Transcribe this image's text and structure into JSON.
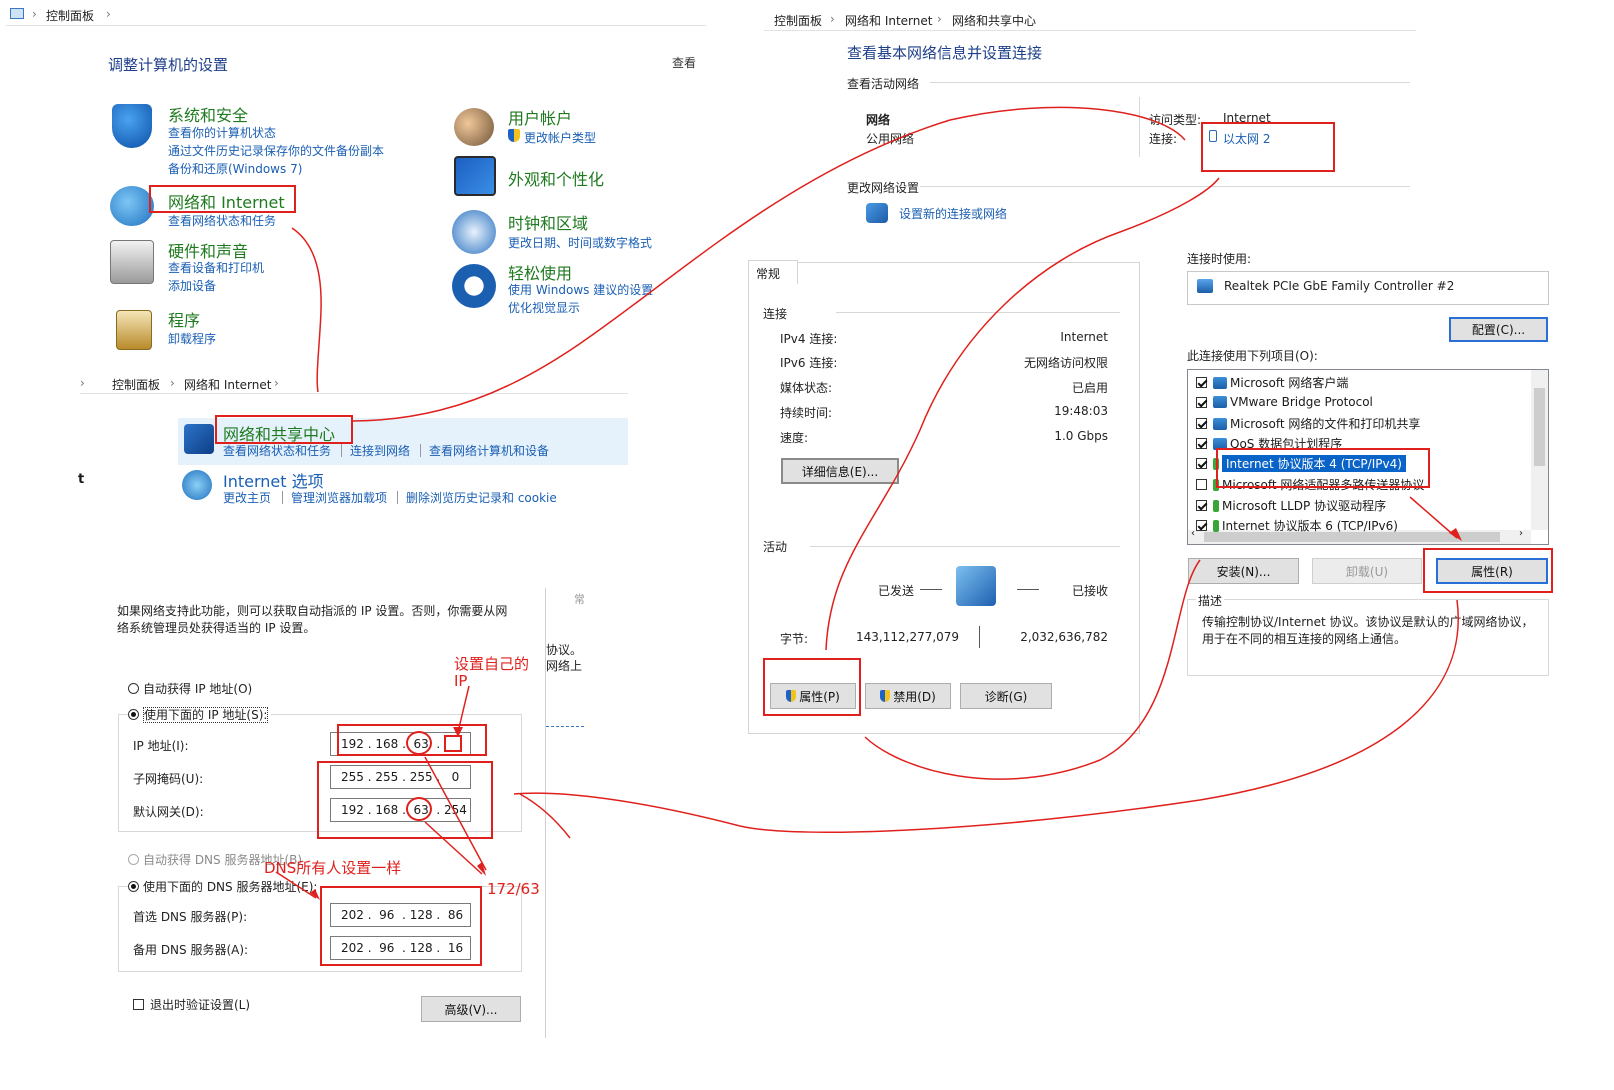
{
  "control_panel": {
    "breadcrumb": [
      "控制面板"
    ],
    "heading": "调整计算机的设置",
    "view_by": "查看",
    "categories_left": [
      {
        "title": "系统和安全",
        "links": [
          "查看你的计算机状态",
          "通过文件历史记录保存你的文件备份副本",
          "备份和还原(Windows 7)"
        ]
      },
      {
        "title": "网络和 Internet",
        "links": [
          "查看网络状态和任务"
        ]
      },
      {
        "title": "硬件和声音",
        "links": [
          "查看设备和打印机",
          "添加设备"
        ]
      },
      {
        "title": "程序",
        "links": [
          "卸载程序"
        ]
      }
    ],
    "categories_right": [
      {
        "title": "用户帐户",
        "links": [
          "更改帐户类型"
        ]
      },
      {
        "title": "外观和个性化",
        "links": []
      },
      {
        "title": "时钟和区域",
        "links": [
          "更改日期、时间或数字格式"
        ]
      },
      {
        "title": "轻松使用",
        "links": [
          "使用 Windows 建议的设置",
          "优化视觉显示"
        ]
      }
    ]
  },
  "network_internet": {
    "breadcrumb": [
      "控制面板",
      "网络和 Internet"
    ],
    "side_char": "t",
    "sharing_center": {
      "title": "网络和共享中心",
      "links": [
        "查看网络状态和任务",
        "连接到网络",
        "查看网络计算机和设备"
      ]
    },
    "internet_options": {
      "title": "Internet 选项",
      "links": [
        "更改主页",
        "管理浏览器加载项",
        "删除浏览历史记录和 cookie"
      ]
    }
  },
  "sharing_center": {
    "breadcrumb": [
      "控制面板",
      "网络和 Internet",
      "网络和共享中心"
    ],
    "heading": "查看基本网络信息并设置连接",
    "active_label": "查看活动网络",
    "network_name": "网络",
    "network_type": "公用网络",
    "access_label": "访问类型:",
    "access_value": "Internet",
    "conn_label": "连接:",
    "conn_value": "以太网 2",
    "change_label": "更改网络设置",
    "new_conn": "设置新的连接或网络"
  },
  "status_dialog": {
    "tab": "常规",
    "section_conn": "连接",
    "rows": [
      {
        "k": "IPv4 连接:",
        "v": "Internet"
      },
      {
        "k": "IPv6 连接:",
        "v": "无网络访问权限"
      },
      {
        "k": "媒体状态:",
        "v": "已启用"
      },
      {
        "k": "持续时间:",
        "v": "19:48:03"
      },
      {
        "k": "速度:",
        "v": "1.0 Gbps"
      }
    ],
    "details_btn": "详细信息(E)...",
    "section_activity": "活动",
    "sent": "已发送",
    "received": "已接收",
    "bytes_label": "字节:",
    "bytes_sent": "143,112,277,079",
    "bytes_recv": "2,032,636,782",
    "btn_props": "属性(P)",
    "btn_disable": "禁用(D)",
    "btn_diag": "诊断(G)"
  },
  "props_dialog": {
    "connect_using": "连接时使用:",
    "adapter": "Realtek PCIe GbE Family Controller #2",
    "configure": "配置(C)...",
    "items_label": "此连接使用下列项目(O):",
    "items": [
      {
        "label": "Microsoft 网络客户端",
        "checked": true
      },
      {
        "label": "VMware Bridge Protocol",
        "checked": true
      },
      {
        "label": "Microsoft 网络的文件和打印机共享",
        "checked": true
      },
      {
        "label": "QoS 数据包计划程序",
        "checked": true
      },
      {
        "label": "Internet 协议版本 4 (TCP/IPv4)",
        "checked": true
      },
      {
        "label": "Microsoft 网络适配器多路传送器协议",
        "checked": false
      },
      {
        "label": "Microsoft LLDP 协议驱动程序",
        "checked": true
      },
      {
        "label": "Internet 协议版本 6 (TCP/IPv6)",
        "checked": true
      }
    ],
    "install": "安装(N)...",
    "uninstall": "卸载(U)",
    "properties": "属性(R)",
    "desc_label": "描述",
    "desc_text": "传输控制协议/Internet 协议。该协议是默认的广域网络协议，用于在不同的相互连接的网络上通信。"
  },
  "ipv4_dialog": {
    "intro": "如果网络支持此功能，则可以获取自动指派的 IP 设置。否则，你需要从网络系统管理员处获得适当的 IP 设置。",
    "auto_ip": "自动获得 IP 地址(O)",
    "manual_ip": "使用下面的 IP 地址(S):",
    "ip_label": "IP 地址(I):",
    "ip_value": "192 . 168 .  63  .   ",
    "mask_label": "子网掩码(U):",
    "mask_value": "255 . 255 . 255 .   0",
    "gw_label": "默认网关(D):",
    "gw_value": "192 . 168 .  63  . 254",
    "auto_dns": "自动获得 DNS 服务器地址(B)",
    "manual_dns": "使用下面的 DNS 服务器地址(E):",
    "dns1_label": "首选 DNS 服务器(P):",
    "dns1_value": "202 .  96  . 128 .  86",
    "dns2_label": "备用 DNS 服务器(A):",
    "dns2_value": "202 .  96  . 128 .  16",
    "validate": "退出时验证设置(L)",
    "advanced": "高级(V)...",
    "back_text1": "协议。",
    "back_text2": "网络上",
    "back_tab": "常"
  },
  "annotations": {
    "set_ip": "设置自己的",
    "set_ip2": "IP",
    "dns_note": "DNS所有人设置一样",
    "gw_note": "172/63",
    "color": "#e0201c"
  }
}
